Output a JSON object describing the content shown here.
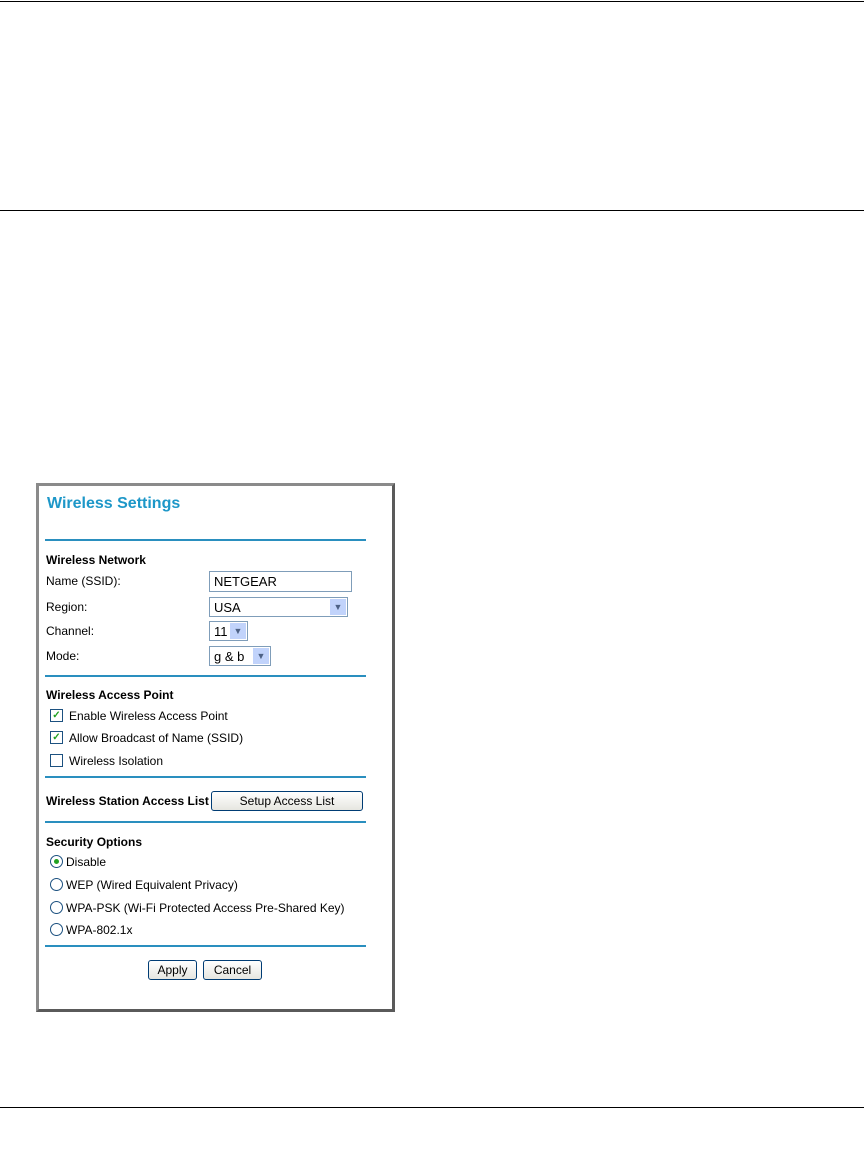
{
  "panel": {
    "title": "Wireless Settings",
    "wireless_network": {
      "heading": "Wireless Network",
      "name_label": "Name (SSID):",
      "name_value": "NETGEAR",
      "region_label": "Region:",
      "region_value": "USA",
      "channel_label": "Channel:",
      "channel_value": "11",
      "mode_label": "Mode:",
      "mode_value": "g & b"
    },
    "access_point": {
      "heading": "Wireless Access Point",
      "options": [
        {
          "label": "Enable Wireless Access Point",
          "checked": true
        },
        {
          "label": "Allow Broadcast of Name (SSID)",
          "checked": true
        },
        {
          "label": "Wireless Isolation",
          "checked": false
        }
      ]
    },
    "station_list": {
      "label": "Wireless Station Access List",
      "button": "Setup Access List"
    },
    "security": {
      "heading": "Security Options",
      "options": [
        {
          "label": "Disable",
          "selected": true
        },
        {
          "label": "WEP (Wired Equivalent Privacy)",
          "selected": false
        },
        {
          "label": "WPA-PSK (Wi-Fi Protected Access Pre-Shared Key)",
          "selected": false
        },
        {
          "label": "WPA-802.1x",
          "selected": false
        }
      ]
    },
    "apply": "Apply",
    "cancel": "Cancel"
  }
}
